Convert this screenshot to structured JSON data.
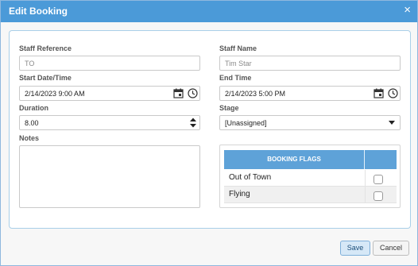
{
  "dialog": {
    "title": "Edit Booking",
    "close_symbol": "×"
  },
  "fields": {
    "staff_reference": {
      "label": "Staff Reference",
      "value": "TO"
    },
    "staff_name": {
      "label": "Staff Name",
      "value": "Tim Star"
    },
    "start": {
      "label": "Start Date/Time",
      "value": "2/14/2023 9:00 AM"
    },
    "end": {
      "label": "End Time",
      "value": "2/14/2023 5:00 PM"
    },
    "duration": {
      "label": "Duration",
      "value": "8.00"
    },
    "stage": {
      "label": "Stage",
      "value": "[Unassigned]"
    },
    "notes": {
      "label": "Notes",
      "value": ""
    }
  },
  "flags": {
    "header": "BOOKING FLAGS",
    "rows": [
      {
        "label": "Out of Town",
        "checked": false
      },
      {
        "label": "Flying",
        "checked": false
      }
    ]
  },
  "buttons": {
    "save": "Save",
    "cancel": "Cancel"
  },
  "colors": {
    "titlebar": "#4b9ad8",
    "flags_header": "#5ea2d8",
    "save_button": "#d6e8f7"
  },
  "icons": [
    "calendar-icon",
    "clock-icon",
    "spinner-up-icon",
    "spinner-down-icon",
    "dropdown-caret-icon",
    "close-icon"
  ]
}
